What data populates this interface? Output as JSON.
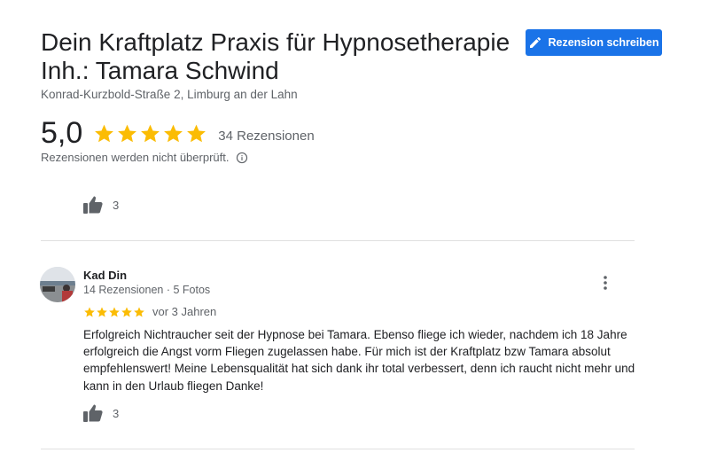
{
  "business": {
    "name": "Dein Kraftplatz Praxis für Hypnosetherapie Inh.: Tamara Schwind",
    "address": "Konrad-Kurzbold-Straße 2, Limburg an der Lahn"
  },
  "write_review_button": {
    "label": "Rezension schreiben",
    "icon": "pencil-icon"
  },
  "rating": {
    "value": "5,0",
    "stars": 5,
    "count_label": "34 Rezensionen",
    "disclaimer": "Rezensionen werden nicht überprüft.",
    "star_color": "#fbbc04"
  },
  "previous_review": {
    "likes": "3"
  },
  "review": {
    "reviewer_name": "Kad Din",
    "reviewer_meta": "14 Rezensionen · 5 Fotos",
    "stars": 5,
    "date": "vor 3 Jahren",
    "text": "Erfolgreich Nichtraucher seit der Hypnose bei Tamara. Ebenso fliege ich wieder, nachdem ich 18 Jahre erfolgreich die Angst vorm Fliegen zugelassen habe. Für mich ist der Kraftplatz bzw Tamara absolut empfehlenswert! Meine Lebensqualität hat sich dank ihr total verbessert, denn ich raucht nicht mehr und kann in den Urlaub fliegen Danke!",
    "likes": "3"
  },
  "colors": {
    "accent": "#1a73e8",
    "star": "#fbbc04"
  }
}
